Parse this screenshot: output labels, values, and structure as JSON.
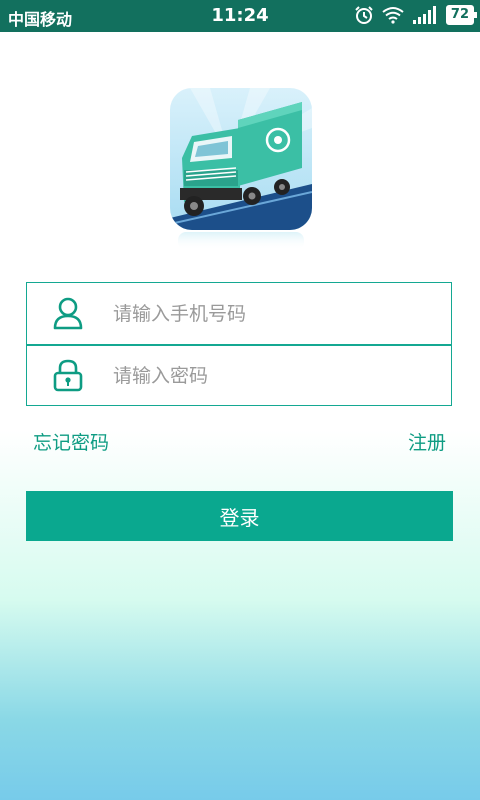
{
  "status_bar": {
    "carrier": "中国移动",
    "time": "11:24",
    "battery": "72",
    "icons": [
      "alarm-icon",
      "wifi-icon",
      "signal-icon",
      "battery-icon"
    ]
  },
  "logo": {
    "icon": "truck-app-logo"
  },
  "login_form": {
    "phone_placeholder": "请输入手机号码",
    "phone_value": "",
    "phone_icon": "user-icon",
    "password_placeholder": "请输入密码",
    "password_value": "",
    "password_icon": "lock-icon"
  },
  "links": {
    "forgot_password": "忘记密码",
    "register": "注册"
  },
  "login_button": "登录",
  "colors": {
    "status_bar": "#12705e",
    "accent": "#0aa88f",
    "link": "#0e9c83"
  }
}
